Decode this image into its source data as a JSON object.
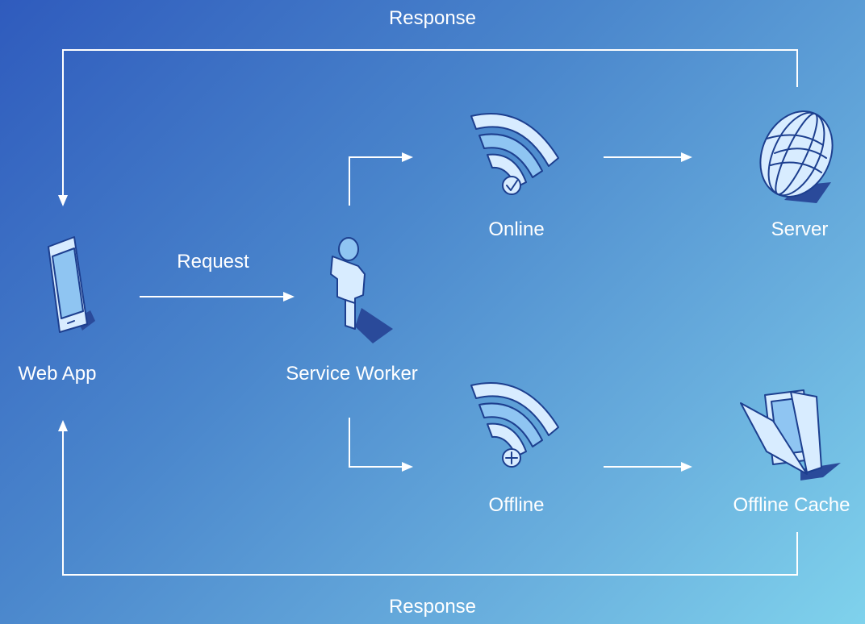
{
  "diagram": {
    "labels": {
      "response_top": "Response",
      "response_bottom": "Response",
      "request": "Request",
      "web_app": "Web App",
      "service_worker": "Service Worker",
      "online": "Online",
      "server": "Server",
      "offline": "Offline",
      "offline_cache": "Offline Cache"
    },
    "icons": {
      "web_app": "smartphone-icon",
      "service_worker": "person-icon",
      "online": "wifi-check-icon",
      "server": "globe-icon",
      "offline": "wifi-plus-icon",
      "offline_cache": "open-folder-icon"
    },
    "colors": {
      "background_start": "#2f5bbd",
      "background_end": "#7fd2ec",
      "line": "#ffffff",
      "icon_fill": "#d8ecff",
      "icon_stroke": "#1d3f8f"
    }
  }
}
